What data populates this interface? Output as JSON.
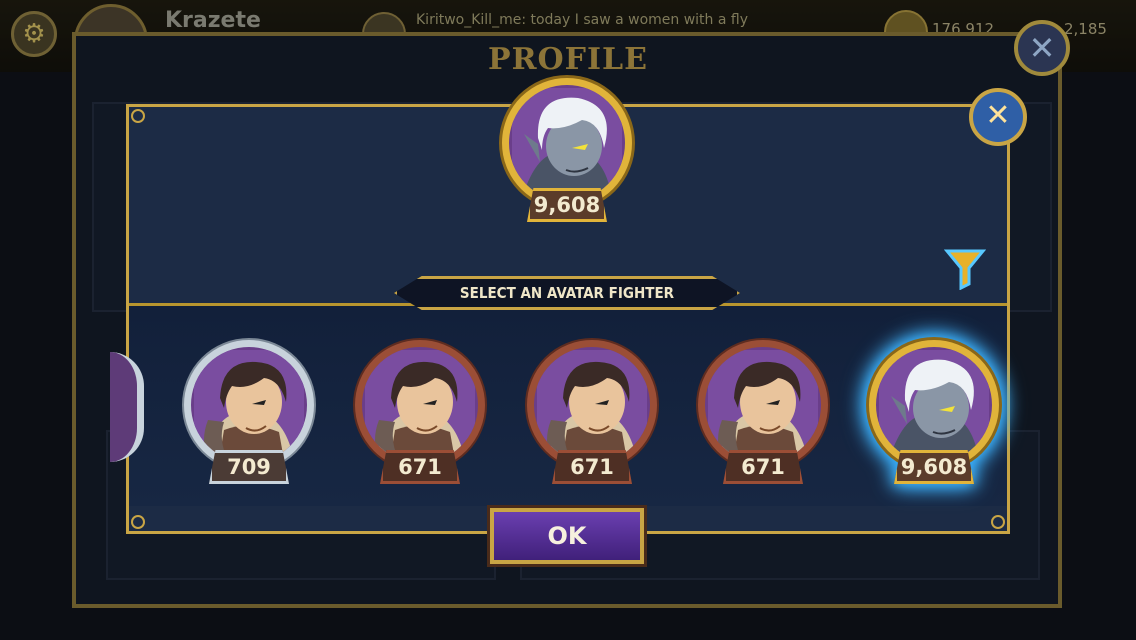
{
  "header": {
    "username": "Krazete",
    "chat_message": "Kiritwo_Kill_me: today I saw a women with a fly",
    "coins": "176,912",
    "gems": "2,185"
  },
  "profile": {
    "title": "PROFILE"
  },
  "modal": {
    "banner": "SELECT AN AVATAR FIGHTER",
    "current_avatar": {
      "score": "9,608",
      "frame": "gold"
    },
    "ok_label": "OK"
  },
  "avatars": [
    {
      "score": "709",
      "frame": "silver"
    },
    {
      "score": "671",
      "frame": "bronze"
    },
    {
      "score": "671",
      "frame": "bronze"
    },
    {
      "score": "671",
      "frame": "bronze"
    },
    {
      "score": "9,608",
      "frame": "gold",
      "selected": true
    }
  ],
  "icons": [
    "gear-icon",
    "chat-icon",
    "coin-icon",
    "close-icon",
    "filter-icon"
  ],
  "colors": {
    "gold": "#c9a545",
    "panel": "#1c2b45",
    "accent_glow": "#2aa7ff",
    "ok": "#5a2fa0"
  }
}
